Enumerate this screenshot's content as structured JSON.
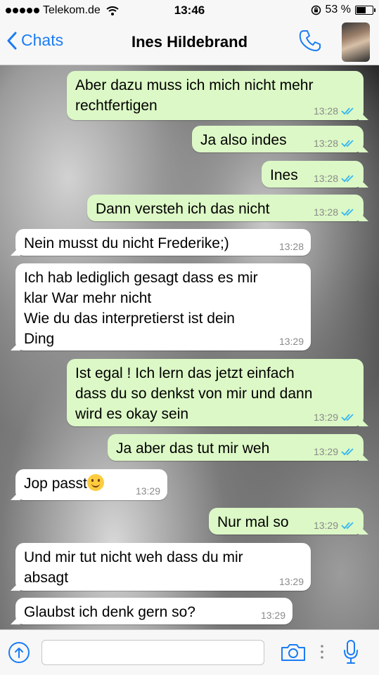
{
  "status_bar": {
    "carrier": "Telekom.de",
    "time": "13:46",
    "battery": "53 %",
    "battery_level": 0.53
  },
  "nav": {
    "back_label": "Chats",
    "title": "Ines Hildebrand"
  },
  "messages": [
    {
      "dir": "out",
      "text": "Aber dazu muss ich mich nicht mehr\nrechtfertigen",
      "time": "13:28",
      "read": true
    },
    {
      "dir": "out",
      "text": "Ja also indes",
      "time": "13:28",
      "read": true
    },
    {
      "dir": "out",
      "text": "Ines",
      "time": "13:28",
      "read": true
    },
    {
      "dir": "out",
      "text": "Dann versteh ich das nicht",
      "time": "13:28",
      "read": true
    },
    {
      "dir": "in",
      "text": "Nein musst du nicht Frederike;)",
      "time": "13:28"
    },
    {
      "dir": "in",
      "text": "Ich hab lediglich gesagt dass es mir\nklar War mehr nicht\nWie du das interpretierst ist dein\nDing",
      "time": "13:29"
    },
    {
      "dir": "out",
      "text": "Ist egal ! Ich lern das jetzt einfach\ndass du so denkst von mir und dann\nwird es okay sein",
      "time": "13:29",
      "read": true
    },
    {
      "dir": "out",
      "text": "Ja aber das tut mir weh",
      "time": "13:29",
      "read": true
    },
    {
      "dir": "in",
      "text": "Jop passt",
      "time": "13:29",
      "emoji": "smiling-face"
    },
    {
      "dir": "out",
      "text": "Nur mal so",
      "time": "13:29",
      "read": true
    },
    {
      "dir": "in",
      "text": "Und mir tut nicht weh dass du mir\nabsagt",
      "time": "13:29"
    },
    {
      "dir": "in",
      "text": "Glaubst ich denk gern so?",
      "time": "13:29"
    }
  ],
  "input": {
    "placeholder": ""
  },
  "colors": {
    "accent": "#1a7cf5",
    "outgoing_bubble": "#dcf8c6",
    "incoming_bubble": "#ffffff",
    "read_ticks": "#34b7f1"
  },
  "icons": [
    "wifi-icon",
    "battery-icon",
    "chevron-left-icon",
    "phone-icon",
    "upload-icon",
    "camera-icon",
    "microphone-icon"
  ]
}
